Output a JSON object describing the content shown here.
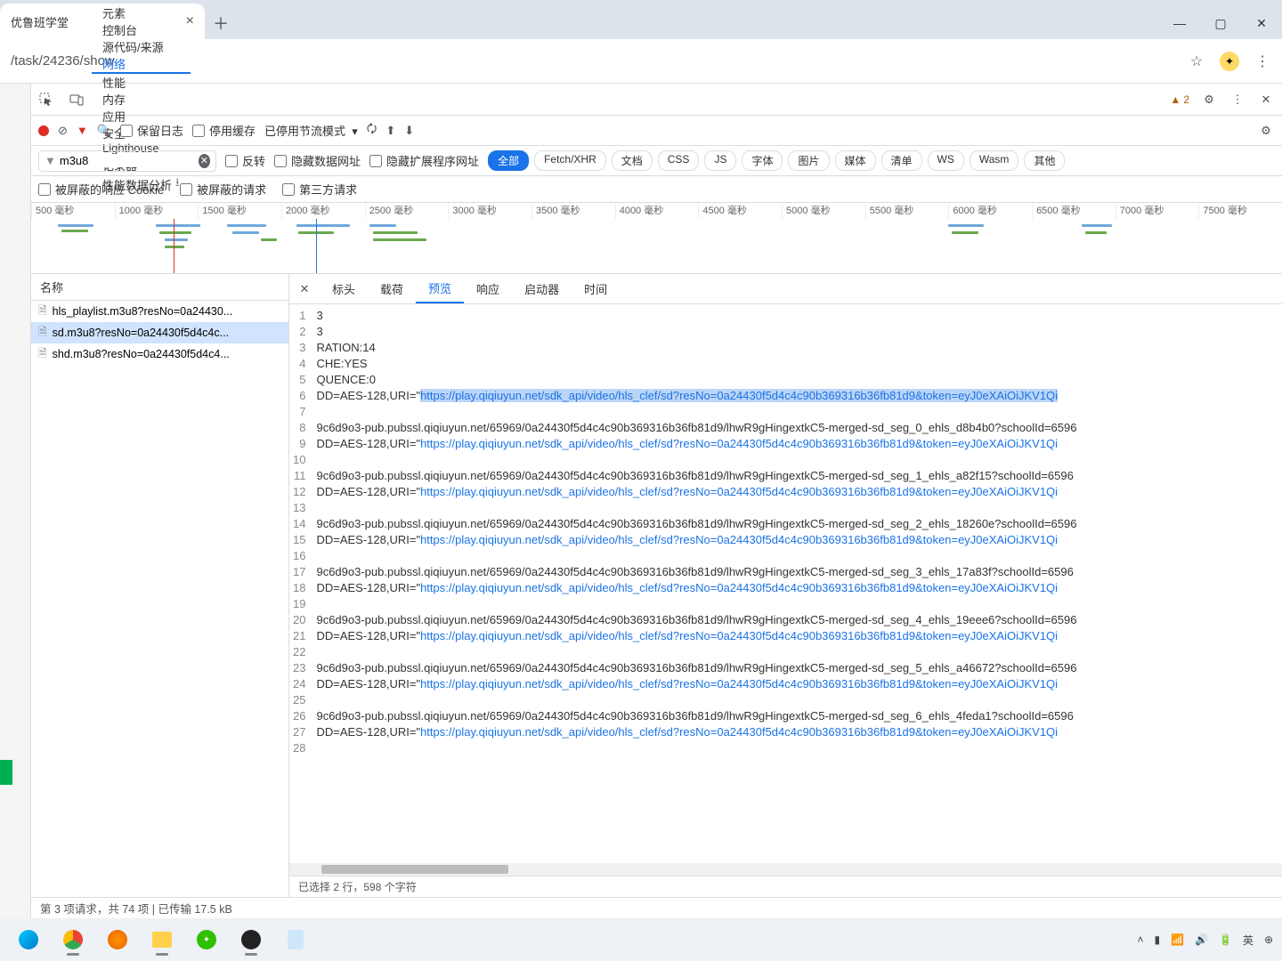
{
  "browser": {
    "tab_title": "优鲁班学堂",
    "url": "/task/24236/show"
  },
  "devtools": {
    "tabs": [
      "元素",
      "控制台",
      "源代码/来源",
      "网络",
      "性能",
      "内存",
      "应用",
      "安全",
      "Lighthouse",
      "记录器",
      "性能数据分析"
    ],
    "active_tab": "网络",
    "warning_count": "2",
    "toolbar": {
      "preserve_log": "保留日志",
      "disable_cache": "停用缓存",
      "throttling": "已停用节流模式"
    },
    "filter": {
      "value": "m3u8",
      "invert": "反转",
      "hide_data_urls": "隐藏数据网址",
      "hide_ext_urls": "隐藏扩展程序网址",
      "types": [
        "全部",
        "Fetch/XHR",
        "文档",
        "CSS",
        "JS",
        "字体",
        "图片",
        "媒体",
        "清单",
        "WS",
        "Wasm",
        "其他"
      ],
      "active_type": "全部"
    },
    "filter2": {
      "blocked_cookies": "被屏蔽的响应 Cookie",
      "blocked_requests": "被屏蔽的请求",
      "third_party": "第三方请求"
    },
    "timeline_ticks": [
      "500 毫秒",
      "1000 毫秒",
      "1500 毫秒",
      "2000 毫秒",
      "2500 毫秒",
      "3000 毫秒",
      "3500 毫秒",
      "4000 毫秒",
      "4500 毫秒",
      "5000 毫秒",
      "5500 毫秒",
      "6000 毫秒",
      "6500 毫秒",
      "7000 毫秒",
      "7500 毫秒"
    ],
    "name_col": "名称",
    "requests": [
      "hls_playlist.m3u8?resNo=0a24430...",
      "sd.m3u8?resNo=0a24430f5d4c4c...",
      "shd.m3u8?resNo=0a24430f5d4c4..."
    ],
    "selected_request_index": 1,
    "detail_tabs": [
      "标头",
      "载荷",
      "预览",
      "响应",
      "启动器",
      "时间"
    ],
    "active_detail_tab": "预览",
    "code_lines": [
      "3",
      "3",
      "RATION:14",
      "CHE:YES",
      "QUENCE:0",
      "DD=AES-128,URI=\"https://play.qiqiuyun.net/sdk_api/video/hls_clef/sd?resNo=0a24430f5d4c4c90b369316b36fb81d9&token=eyJ0eXAiOiJKV1Qi",
      "",
      "9c6d9o3-pub.pubssl.qiqiuyun.net/65969/0a24430f5d4c4c90b369316b36fb81d9/lhwR9gHingextkC5-merged-sd_seg_0_ehls_d8b4b0?schoolId=6596",
      "DD=AES-128,URI=\"https://play.qiqiuyun.net/sdk_api/video/hls_clef/sd?resNo=0a24430f5d4c4c90b369316b36fb81d9&token=eyJ0eXAiOiJKV1Qi",
      "",
      "9c6d9o3-pub.pubssl.qiqiuyun.net/65969/0a24430f5d4c4c90b369316b36fb81d9/lhwR9gHingextkC5-merged-sd_seg_1_ehls_a82f15?schoolId=6596",
      "DD=AES-128,URI=\"https://play.qiqiuyun.net/sdk_api/video/hls_clef/sd?resNo=0a24430f5d4c4c90b369316b36fb81d9&token=eyJ0eXAiOiJKV1Qi",
      "",
      "9c6d9o3-pub.pubssl.qiqiuyun.net/65969/0a24430f5d4c4c90b369316b36fb81d9/lhwR9gHingextkC5-merged-sd_seg_2_ehls_18260e?schoolId=6596",
      "DD=AES-128,URI=\"https://play.qiqiuyun.net/sdk_api/video/hls_clef/sd?resNo=0a24430f5d4c4c90b369316b36fb81d9&token=eyJ0eXAiOiJKV1Qi",
      "",
      "9c6d9o3-pub.pubssl.qiqiuyun.net/65969/0a24430f5d4c4c90b369316b36fb81d9/lhwR9gHingextkC5-merged-sd_seg_3_ehls_17a83f?schoolId=6596",
      "DD=AES-128,URI=\"https://play.qiqiuyun.net/sdk_api/video/hls_clef/sd?resNo=0a24430f5d4c4c90b369316b36fb81d9&token=eyJ0eXAiOiJKV1Qi",
      "",
      "9c6d9o3-pub.pubssl.qiqiuyun.net/65969/0a24430f5d4c4c90b369316b36fb81d9/lhwR9gHingextkC5-merged-sd_seg_4_ehls_19eee6?schoolId=6596",
      "DD=AES-128,URI=\"https://play.qiqiuyun.net/sdk_api/video/hls_clef/sd?resNo=0a24430f5d4c4c90b369316b36fb81d9&token=eyJ0eXAiOiJKV1Qi",
      "",
      "9c6d9o3-pub.pubssl.qiqiuyun.net/65969/0a24430f5d4c4c90b369316b36fb81d9/lhwR9gHingextkC5-merged-sd_seg_5_ehls_a46672?schoolId=6596",
      "DD=AES-128,URI=\"https://play.qiqiuyun.net/sdk_api/video/hls_clef/sd?resNo=0a24430f5d4c4c90b369316b36fb81d9&token=eyJ0eXAiOiJKV1Qi",
      "",
      "9c6d9o3-pub.pubssl.qiqiuyun.net/65969/0a24430f5d4c4c90b369316b36fb81d9/lhwR9gHingextkC5-merged-sd_seg_6_ehls_4feda1?schoolId=6596",
      "DD=AES-128,URI=\"https://play.qiqiuyun.net/sdk_api/video/hls_clef/sd?resNo=0a24430f5d4c4c90b369316b36fb81d9&token=eyJ0eXAiOiJKV1Qi",
      ""
    ],
    "selection_line_index": 5,
    "selection_text": "https://play.qiqiuyun.net/sdk_api/video/hls_clef/sd?resNo=0a24430f5d4c4c90b369316b36fb81d9&token=eyJ0eXAiOiJKV1Qi",
    "detail_status": "已选择 2 行，598 个字符",
    "status_bar": "第 3 项请求，共 74 项  |  已传输 17.5 kB"
  },
  "taskbar": {
    "ime": "英"
  }
}
